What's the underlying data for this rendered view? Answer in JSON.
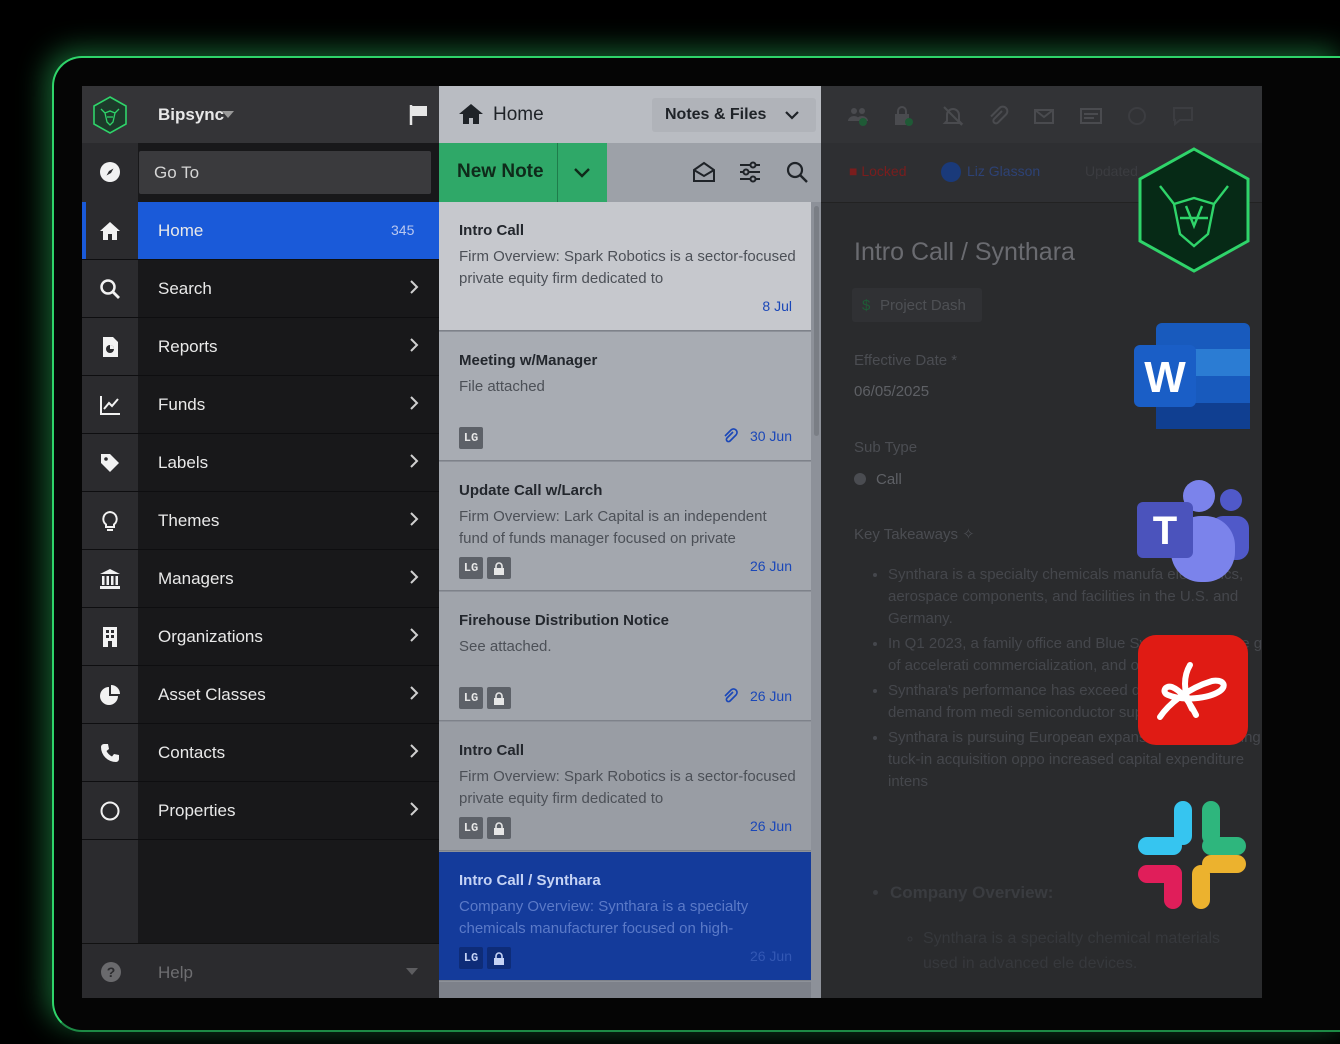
{
  "sidebar": {
    "brand": "Bipsync",
    "goto_placeholder": "Go To",
    "items": [
      {
        "label": "Home",
        "count": "345",
        "icon": "home-icon"
      },
      {
        "label": "Search",
        "icon": "search-icon"
      },
      {
        "label": "Reports",
        "icon": "report-icon"
      },
      {
        "label": "Funds",
        "icon": "chart-line-icon"
      },
      {
        "label": "Labels",
        "icon": "tag-icon"
      },
      {
        "label": "Themes",
        "icon": "lightbulb-icon"
      },
      {
        "label": "Managers",
        "icon": "bank-icon"
      },
      {
        "label": "Organizations",
        "icon": "building-icon"
      },
      {
        "label": "Asset Classes",
        "icon": "pie-chart-icon"
      },
      {
        "label": "Contacts",
        "icon": "phone-icon"
      },
      {
        "label": "Properties",
        "icon": "circle-icon"
      }
    ],
    "help": "Help"
  },
  "list": {
    "title": "Home",
    "filter": "Notes & Files",
    "new_note": "New Note",
    "cards": [
      {
        "title": "Intro Call",
        "snippet": "Firm Overview: Spark Robotics is a sector-focused private equity firm dedicated to",
        "date": "8 Jul",
        "tags": [],
        "clip": false,
        "lock": false
      },
      {
        "title": "Meeting w/Manager",
        "snippet": "File attached",
        "date": "30 Jun",
        "tags": [
          "LG"
        ],
        "clip": true,
        "lock": false
      },
      {
        "title": "Update Call w/Larch",
        "snippet": "Firm Overview: Lark Capital is an independent fund of funds manager focused on private",
        "date": "26 Jun",
        "tags": [
          "LG"
        ],
        "clip": false,
        "lock": true
      },
      {
        "title": "Firehouse Distribution Notice",
        "snippet": "See attached.",
        "date": "26 Jun",
        "tags": [
          "LG"
        ],
        "clip": true,
        "lock": true
      },
      {
        "title": "Intro Call",
        "snippet": "Firm Overview: Spark Robotics is a sector-focused private equity firm dedicated to",
        "date": "26 Jun",
        "tags": [
          "LG"
        ],
        "clip": false,
        "lock": true
      },
      {
        "title": "Intro Call / Synthara",
        "snippet": "Company Overview: Synthara is a specialty chemicals manufacturer focused on high-",
        "date": "26 Jun",
        "tags": [
          "LG"
        ],
        "clip": false,
        "lock": true,
        "selected": true
      }
    ]
  },
  "detail": {
    "locked": "Locked",
    "user": "Liz Glasson",
    "updated": "Updated",
    "title": "Intro Call / Synthara",
    "project": "Project Dash",
    "effective_date_label": "Effective Date",
    "effective_date": "06/05/2025",
    "sub_type_label": "Sub Type",
    "sub_type": "Call",
    "key_takeaways": "Key Takeaways",
    "bullets": [
      "Synthara is a specialty chemicals manufa electronics, aerospace components, and facilities in the U.S. and Germany.",
      "In Q1 2023, a family office and Blue Synthara, with the goal of accelerati commercialization, and operational",
      "Synthara's performance has exceed driven by strong demand from medi semiconductor supplier.",
      "Synthara is pursuing European expansion and exploring tuck-in acquisition oppo increased capital expenditure intens"
    ],
    "company_overview": "Company Overview:",
    "sub_bullet": "Synthara is a specialty chemical materials used in advanced ele devices."
  },
  "integrations": [
    "bipsync-bull-icon",
    "word-icon",
    "teams-icon",
    "acrobat-icon",
    "slack-icon"
  ],
  "colors": {
    "accent": "#1a5ad9",
    "green": "#2fa868",
    "glow": "#2fd46a"
  }
}
